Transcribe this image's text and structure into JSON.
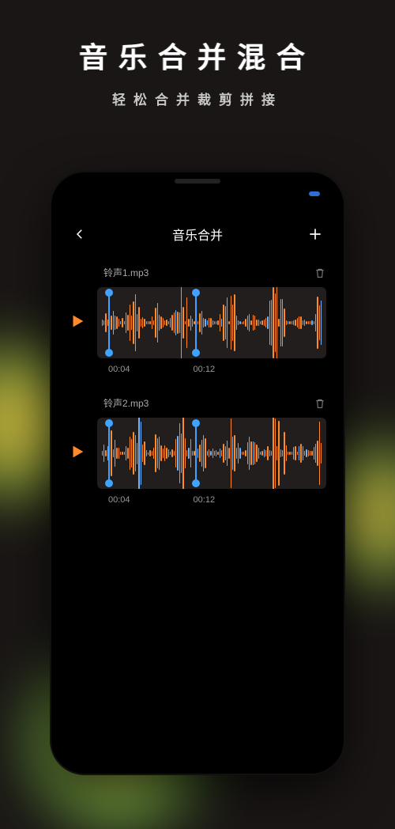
{
  "hero": {
    "title": "音乐合并混合",
    "subtitle": "轻松合并裁剪拼接"
  },
  "app": {
    "title": "音乐合并"
  },
  "tracks": [
    {
      "name": "铃声1.mp3",
      "start": "00:04",
      "end": "00:12"
    },
    {
      "name": "铃声2.mp3",
      "start": "00:04",
      "end": "00:12"
    }
  ]
}
